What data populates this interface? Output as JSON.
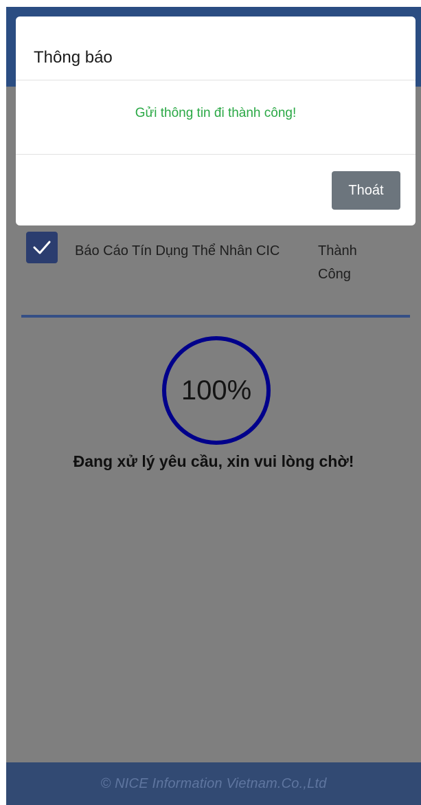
{
  "dialog": {
    "title": "Thông báo",
    "message": "Gửi thông tin đi thành công!",
    "button_label": "Thoát",
    "message_color": "#2aa845"
  },
  "list": {
    "items": [
      {
        "checked": true,
        "label": "Báo Cáo Tín Dụng Thể Nhân CIC",
        "status": "Thành Công"
      }
    ]
  },
  "progress": {
    "percent_text": "100%",
    "percent": 100,
    "ring_color": "#00008b",
    "status_text": "Đang xử lý yêu cầu, xin vui lòng chờ!"
  },
  "footer": {
    "copyright": "© NICE Information Vietnam.Co.,Ltd"
  },
  "colors": {
    "header": "#2b4d82",
    "overlay_bg": "#7f7f7f",
    "footer": "#324a73",
    "checkbox": "#2b3d6f",
    "button": "#6c757d"
  },
  "icons": {
    "checkbox": "check-icon"
  }
}
